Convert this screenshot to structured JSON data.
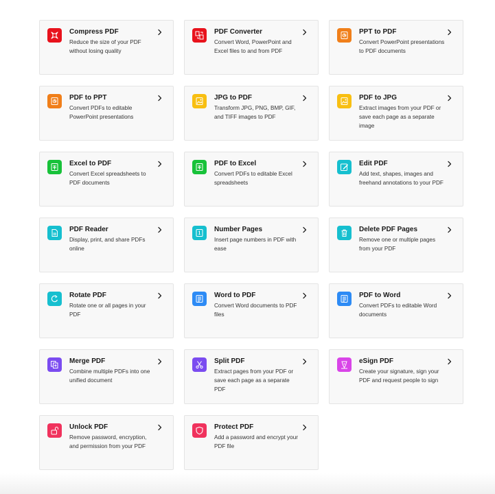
{
  "tools": [
    {
      "id": "compress-pdf",
      "title": "Compress PDF",
      "description": "Reduce the size of your PDF without losing quality",
      "color": "#e8121c",
      "icon": "compress-icon"
    },
    {
      "id": "pdf-converter",
      "title": "PDF Converter",
      "description": "Convert Word, PowerPoint and Excel files to and from PDF",
      "color": "#e8121c",
      "icon": "convert-icon"
    },
    {
      "id": "ppt-to-pdf",
      "title": "PPT to PDF",
      "description": "Convert PowerPoint presentations to PDF documents",
      "color": "#f07f1a",
      "icon": "ppt-icon"
    },
    {
      "id": "pdf-to-ppt",
      "title": "PDF to PPT",
      "description": "Convert PDFs to editable PowerPoint presentations",
      "color": "#f07f1a",
      "icon": "ppt-icon"
    },
    {
      "id": "jpg-to-pdf",
      "title": "JPG to PDF",
      "description": "Transform JPG, PNG, BMP, GIF, and TIFF images to PDF",
      "color": "#f8bf12",
      "icon": "image-icon"
    },
    {
      "id": "pdf-to-jpg",
      "title": "PDF to JPG",
      "description": "Extract images from your PDF or save each page as a separate image",
      "color": "#f8bf12",
      "icon": "image-icon"
    },
    {
      "id": "excel-to-pdf",
      "title": "Excel to PDF",
      "description": "Convert Excel spreadsheets to PDF documents",
      "color": "#18c23a",
      "icon": "excel-icon"
    },
    {
      "id": "pdf-to-excel",
      "title": "PDF to Excel",
      "description": "Convert PDFs to editable Excel spreadsheets",
      "color": "#18c23a",
      "icon": "excel-icon"
    },
    {
      "id": "edit-pdf",
      "title": "Edit PDF",
      "description": "Add text, shapes, images and freehand annotations to your PDF",
      "color": "#16bfcf",
      "icon": "pencil-icon"
    },
    {
      "id": "pdf-reader",
      "title": "PDF Reader",
      "description": "Display, print, and share PDFs online",
      "color": "#16bfcf",
      "icon": "document-icon"
    },
    {
      "id": "number-pages",
      "title": "Number Pages",
      "description": "Insert page numbers in PDF with ease",
      "color": "#16bfcf",
      "icon": "number-icon"
    },
    {
      "id": "delete-pdf-pages",
      "title": "Delete PDF Pages",
      "description": "Remove one or multiple pages from your PDF",
      "color": "#16bfcf",
      "icon": "trash-icon"
    },
    {
      "id": "rotate-pdf",
      "title": "Rotate PDF",
      "description": "Rotate one or all pages in your PDF",
      "color": "#16bfcf",
      "icon": "rotate-icon"
    },
    {
      "id": "word-to-pdf",
      "title": "Word to PDF",
      "description": "Convert Word documents to PDF files",
      "color": "#2d8bf5",
      "icon": "word-icon"
    },
    {
      "id": "pdf-to-word",
      "title": "PDF to Word",
      "description": "Convert PDFs to editable Word documents",
      "color": "#2d8bf5",
      "icon": "word-icon"
    },
    {
      "id": "merge-pdf",
      "title": "Merge PDF",
      "description": "Combine multiple PDFs into one unified document",
      "color": "#7b4cf0",
      "icon": "merge-icon"
    },
    {
      "id": "split-pdf",
      "title": "Split PDF",
      "description": "Extract pages from your PDF or save each page as a separate PDF",
      "color": "#7b4cf0",
      "icon": "scissors-icon"
    },
    {
      "id": "esign-pdf",
      "title": "eSign PDF",
      "description": "Create your signature, sign your PDF and request people to sign",
      "color": "#d945e8",
      "icon": "pen-icon"
    },
    {
      "id": "unlock-pdf",
      "title": "Unlock PDF",
      "description": "Remove password, encryption, and permission from your PDF",
      "color": "#f0325d",
      "icon": "unlock-icon"
    },
    {
      "id": "protect-pdf",
      "title": "Protect PDF",
      "description": "Add a password and encrypt your PDF file",
      "color": "#f0325d",
      "icon": "shield-icon"
    }
  ]
}
